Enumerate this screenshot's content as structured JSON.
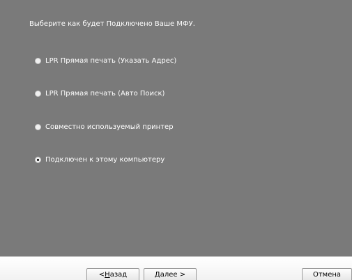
{
  "prompt": "Выберите как будет Подключено Ваше МФУ.",
  "options": [
    {
      "label": "LPR Прямая печать (Указать Адрес)",
      "selected": false
    },
    {
      "label": "LPR Прямая печать (Авто Поиск)",
      "selected": false
    },
    {
      "label": "Совместно используемый принтер",
      "selected": false
    },
    {
      "label": "Подключен к этому компьютеру",
      "selected": true
    }
  ],
  "buttons": {
    "back_prefix": "< ",
    "back_hotkey": "Н",
    "back_rest": "азад",
    "next_hotkey": "Д",
    "next_rest": "алее >",
    "cancel": "Отмена"
  },
  "colors": {
    "panel_background": "#7a7a7a",
    "text": "#ffffff"
  }
}
